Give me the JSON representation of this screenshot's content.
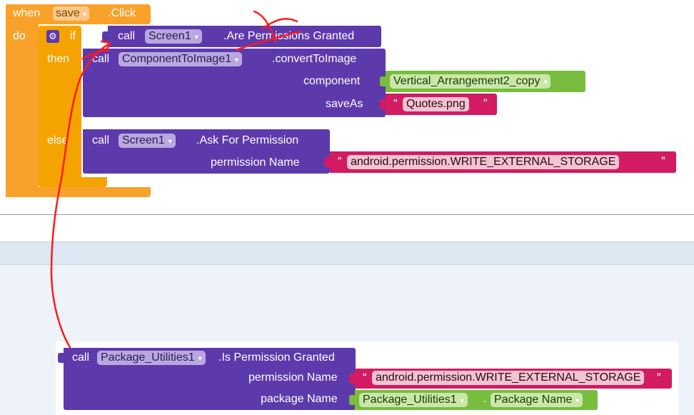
{
  "event_block": {
    "when": "when",
    "component": "save",
    "event": ".Click",
    "do": "do",
    "if_label": "if",
    "then_label": "then",
    "else_label": "else"
  },
  "if_condition": {
    "call": "call",
    "component": "Screen1",
    "method": ".Are Permissions Granted"
  },
  "convert_block": {
    "call": "call",
    "component": "ComponentToImage1",
    "method": ".convertToImage",
    "param1_label": "component",
    "param1_value": "Vertical_Arrangement2_copy",
    "param2_label": "saveAs",
    "param2_value": "Quotes.png"
  },
  "ask_block": {
    "call": "call",
    "component": "Screen1",
    "method": ".Ask For Permission",
    "param_label": "permission Name",
    "param_value": "android.permission.WRITE_EXTERNAL_STORAGE"
  },
  "package_block": {
    "call": "call",
    "component": "Package_Utilities1",
    "method": ".Is Permission Granted",
    "param1_label": "permission Name",
    "param1_value": "android.permission.WRITE_EXTERNAL_STORAGE",
    "param2_label": "package Name",
    "param2_component": "Package_Utilities1",
    "param2_dot": ".",
    "param2_property": "Package Name"
  },
  "quote_open": "“",
  "quote_close": "”",
  "colors": {
    "event_orange": "#f8a22a",
    "procedure_purple": "#5d3aac",
    "component_green": "#79bd3f",
    "text_pink": "#d21b62",
    "annotation_red": "#ff0000"
  }
}
